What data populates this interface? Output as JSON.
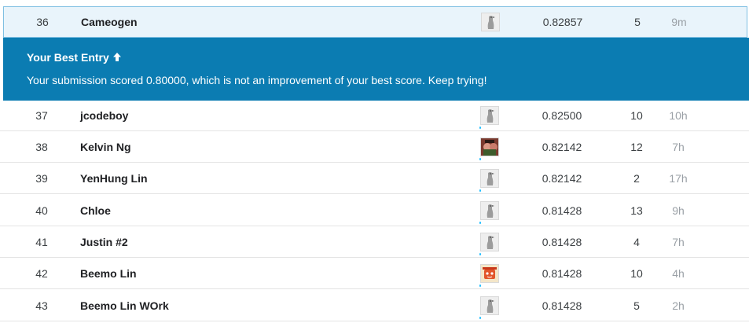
{
  "highlight_row": {
    "rank": "36",
    "team": "Cameogen",
    "avatar": "default-kaggle-avatar-icon",
    "score": "0.82857",
    "entries": "5",
    "last": "9m"
  },
  "banner": {
    "title": "Your Best Entry",
    "title_icon": "arrow-up-icon",
    "message": "Your submission scored 0.80000, which is not an improvement of your best score. Keep trying!",
    "background": "#0b7cb2"
  },
  "rows": [
    {
      "rank": "37",
      "team": "jcodeboy",
      "avatar": "default-kaggle-avatar-icon",
      "score": "0.82500",
      "entries": "10",
      "last": "10h"
    },
    {
      "rank": "38",
      "team": "Kelvin Ng",
      "avatar": "photo-avatar-icon",
      "score": "0.82142",
      "entries": "12",
      "last": "7h"
    },
    {
      "rank": "39",
      "team": "YenHung Lin",
      "avatar": "default-kaggle-avatar-icon",
      "score": "0.82142",
      "entries": "2",
      "last": "17h"
    },
    {
      "rank": "40",
      "team": "Chloe",
      "avatar": "default-kaggle-avatar-icon",
      "score": "0.81428",
      "entries": "13",
      "last": "9h"
    },
    {
      "rank": "41",
      "team": "Justin #2",
      "avatar": "default-kaggle-avatar-icon",
      "score": "0.81428",
      "entries": "4",
      "last": "7h"
    },
    {
      "rank": "42",
      "team": "Beemo Lin",
      "avatar": "cartoon-avatar-icon",
      "score": "0.81428",
      "entries": "10",
      "last": "4h"
    },
    {
      "rank": "43",
      "team": "Beemo Lin WOrk",
      "avatar": "default-kaggle-avatar-icon",
      "score": "0.81428",
      "entries": "5",
      "last": "2h"
    }
  ]
}
